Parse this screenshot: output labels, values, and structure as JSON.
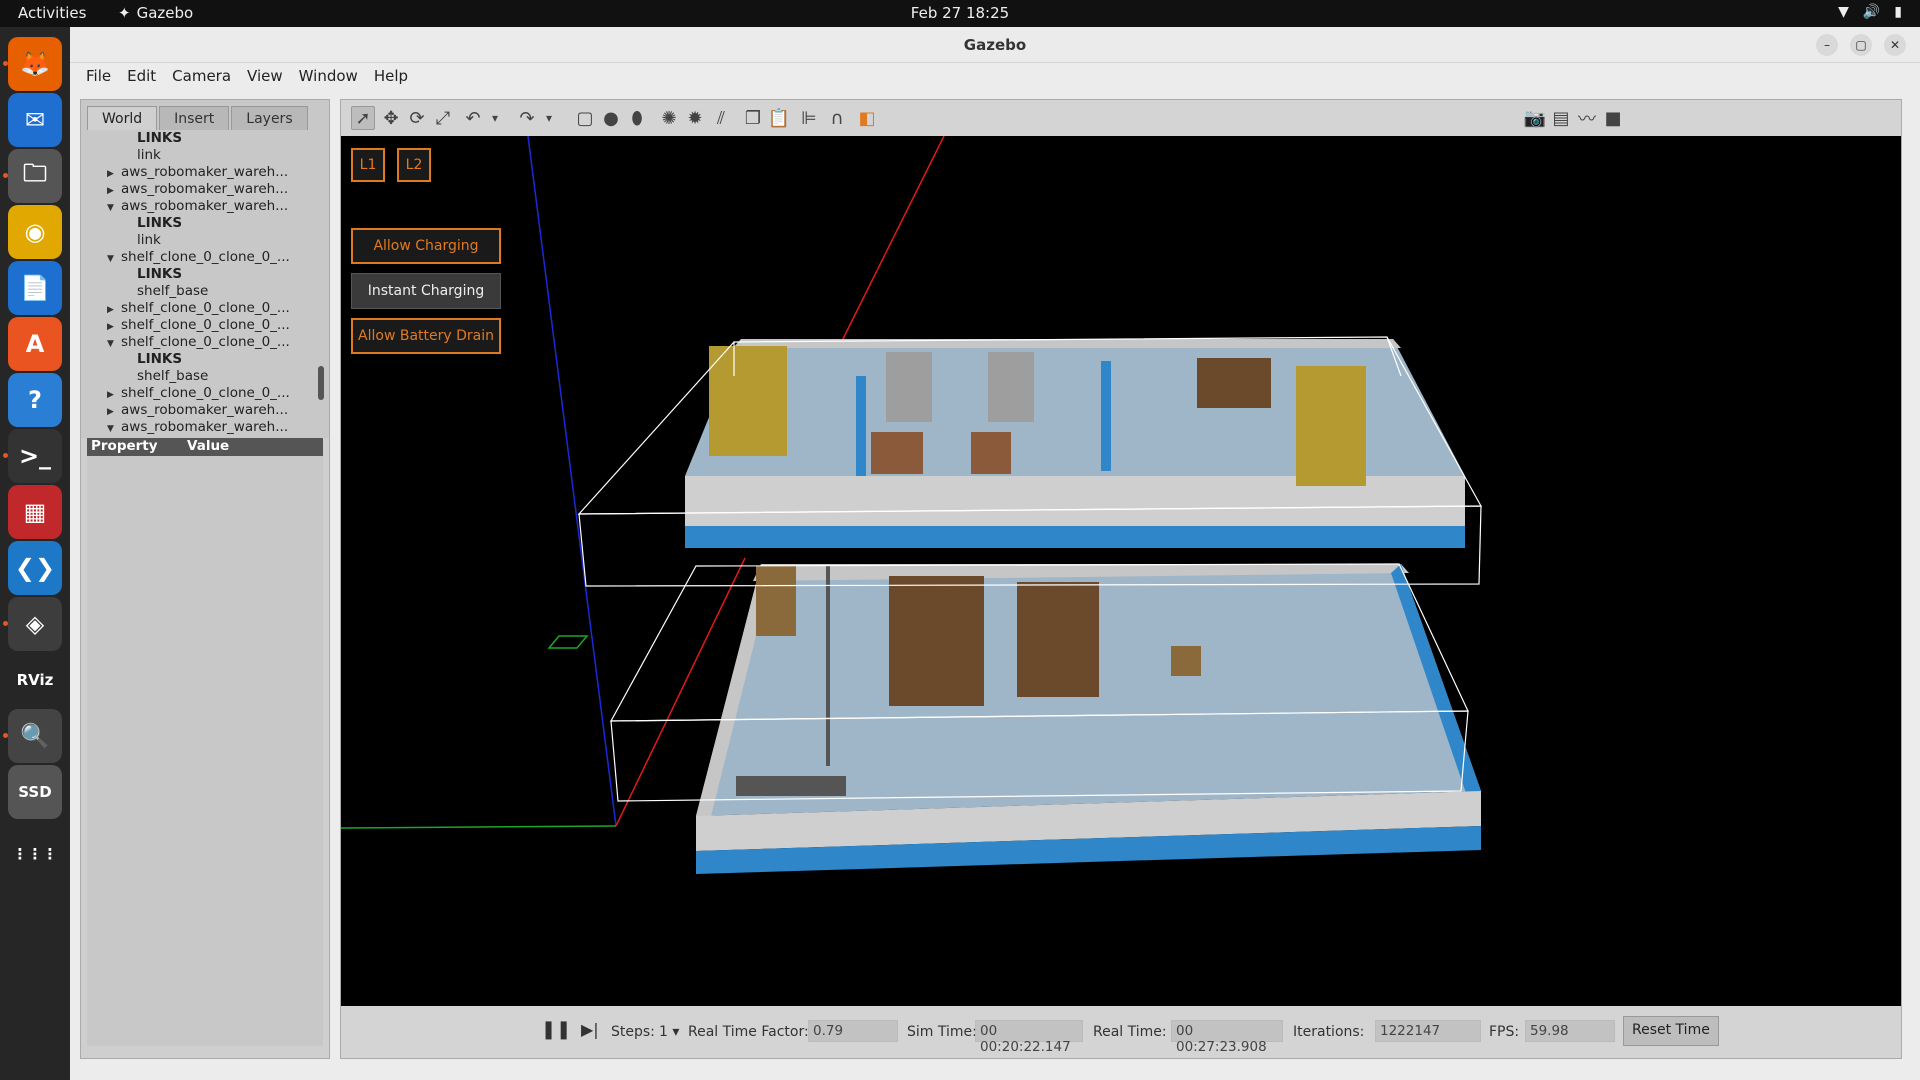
{
  "topbar": {
    "activities": "Activities",
    "app_name": "Gazebo",
    "clock": "Feb 27  18:25"
  },
  "dock": {
    "items": [
      {
        "name": "firefox-icon",
        "glyph": "🦊"
      },
      {
        "name": "thunderbird-icon",
        "glyph": "✉"
      },
      {
        "name": "files-icon",
        "glyph": "🗀"
      },
      {
        "name": "rhythmbox-icon",
        "glyph": "◉"
      },
      {
        "name": "writer-icon",
        "glyph": "📄"
      },
      {
        "name": "app-center-icon",
        "glyph": "A"
      },
      {
        "name": "help-icon",
        "glyph": "?"
      },
      {
        "name": "terminal-icon",
        "glyph": ">_"
      },
      {
        "name": "remote-desktop-icon",
        "glyph": "▦"
      },
      {
        "name": "vscode-icon",
        "glyph": "❮❯"
      },
      {
        "name": "gazebo-icon",
        "glyph": "◈"
      },
      {
        "name": "rviz-icon",
        "glyph": "RViz"
      },
      {
        "name": "image-viewer-icon",
        "glyph": "🔍"
      },
      {
        "name": "ssd-drive-icon",
        "glyph": "SSD"
      },
      {
        "name": "show-apps-icon",
        "glyph": "⋮⋮⋮"
      }
    ]
  },
  "window": {
    "title": "Gazebo",
    "menu": [
      "File",
      "Edit",
      "Camera",
      "View",
      "Window",
      "Help"
    ]
  },
  "leftpanel": {
    "tabs": [
      "World",
      "Insert",
      "Layers"
    ],
    "tree": [
      {
        "indent": 2,
        "arrow": "",
        "text": "LINKS",
        "bold": true
      },
      {
        "indent": 2,
        "arrow": "",
        "text": "link",
        "bold": false
      },
      {
        "indent": 1,
        "arrow": "▶",
        "text": "aws_robomaker_wareh...",
        "bold": false
      },
      {
        "indent": 1,
        "arrow": "▶",
        "text": "aws_robomaker_wareh...",
        "bold": false
      },
      {
        "indent": 1,
        "arrow": "▼",
        "text": "aws_robomaker_wareh...",
        "bold": false
      },
      {
        "indent": 2,
        "arrow": "",
        "text": "LINKS",
        "bold": true
      },
      {
        "indent": 2,
        "arrow": "",
        "text": "link",
        "bold": false
      },
      {
        "indent": 1,
        "arrow": "▼",
        "text": "shelf_clone_0_clone_0_...",
        "bold": false
      },
      {
        "indent": 2,
        "arrow": "",
        "text": "LINKS",
        "bold": true
      },
      {
        "indent": 2,
        "arrow": "",
        "text": "shelf_base",
        "bold": false
      },
      {
        "indent": 1,
        "arrow": "▶",
        "text": "shelf_clone_0_clone_0_...",
        "bold": false
      },
      {
        "indent": 1,
        "arrow": "▶",
        "text": "shelf_clone_0_clone_0_...",
        "bold": false
      },
      {
        "indent": 1,
        "arrow": "▼",
        "text": "shelf_clone_0_clone_0_...",
        "bold": false
      },
      {
        "indent": 2,
        "arrow": "",
        "text": "LINKS",
        "bold": true
      },
      {
        "indent": 2,
        "arrow": "",
        "text": "shelf_base",
        "bold": false
      },
      {
        "indent": 1,
        "arrow": "▶",
        "text": "shelf_clone_0_clone_0_...",
        "bold": false
      },
      {
        "indent": 1,
        "arrow": "▶",
        "text": "aws_robomaker_wareh...",
        "bold": false
      },
      {
        "indent": 1,
        "arrow": "▼",
        "text": "aws_robomaker_wareh...",
        "bold": false
      }
    ],
    "property_header": "Property",
    "value_header": "Value"
  },
  "toolbar": {
    "tools": [
      {
        "name": "select-mode-icon",
        "glyph": "➚",
        "selected": true
      },
      {
        "name": "translate-mode-icon",
        "glyph": "✥",
        "selected": false
      },
      {
        "name": "rotate-mode-icon",
        "glyph": "⟳",
        "selected": false
      },
      {
        "name": "scale-mode-icon",
        "glyph": "⤢",
        "selected": false
      },
      {
        "name": "undo-icon",
        "glyph": "↶",
        "selected": false
      },
      {
        "name": "undo-dropdown-icon",
        "glyph": "▾",
        "selected": false
      },
      {
        "name": "redo-icon",
        "glyph": "↷",
        "selected": false
      },
      {
        "name": "redo-dropdown-icon",
        "glyph": "▾",
        "selected": false
      },
      {
        "name": "box-shape-icon",
        "glyph": "▢",
        "selected": false
      },
      {
        "name": "sphere-shape-icon",
        "glyph": "●",
        "selected": false
      },
      {
        "name": "cylinder-shape-icon",
        "glyph": "⬮",
        "selected": false
      },
      {
        "name": "point-light-icon",
        "glyph": "✺",
        "selected": false
      },
      {
        "name": "spot-light-icon",
        "glyph": "✹",
        "selected": false
      },
      {
        "name": "directional-light-icon",
        "glyph": "⫽",
        "selected": false
      },
      {
        "name": "copy-icon",
        "glyph": "❐",
        "selected": false
      },
      {
        "name": "paste-icon",
        "glyph": "📋",
        "selected": false
      },
      {
        "name": "align-icon",
        "glyph": "⊫",
        "selected": false
      },
      {
        "name": "snap-icon",
        "glyph": "∩",
        "selected": false
      },
      {
        "name": "view-angle-icon",
        "glyph": "◧",
        "selected": false
      }
    ],
    "right_tools": [
      {
        "name": "screenshot-icon",
        "glyph": "📷"
      },
      {
        "name": "log-data-icon",
        "glyph": "▤"
      },
      {
        "name": "plot-icon",
        "glyph": "〰"
      },
      {
        "name": "video-record-icon",
        "glyph": "■"
      }
    ]
  },
  "viewport": {
    "level_buttons": [
      "L1",
      "L2"
    ],
    "plugin_buttons": [
      {
        "label": "Allow Charging",
        "style": "orange"
      },
      {
        "label": "Instant Charging",
        "style": "grey"
      },
      {
        "label": "Allow Battery Drain",
        "style": "orange"
      }
    ]
  },
  "statusbar": {
    "steps_label": "Steps:",
    "steps_value": "1",
    "rtf_label": "Real Time Factor:",
    "rtf_value": "0.79",
    "sim_time_label": "Sim Time:",
    "sim_time_value": "00 00:20:22.147",
    "real_time_label": "Real Time:",
    "real_time_value": "00 00:27:23.908",
    "iterations_label": "Iterations:",
    "iterations_value": "1222147",
    "fps_label": "FPS:",
    "fps_value": "59.98",
    "reset_label": "Reset Time"
  }
}
